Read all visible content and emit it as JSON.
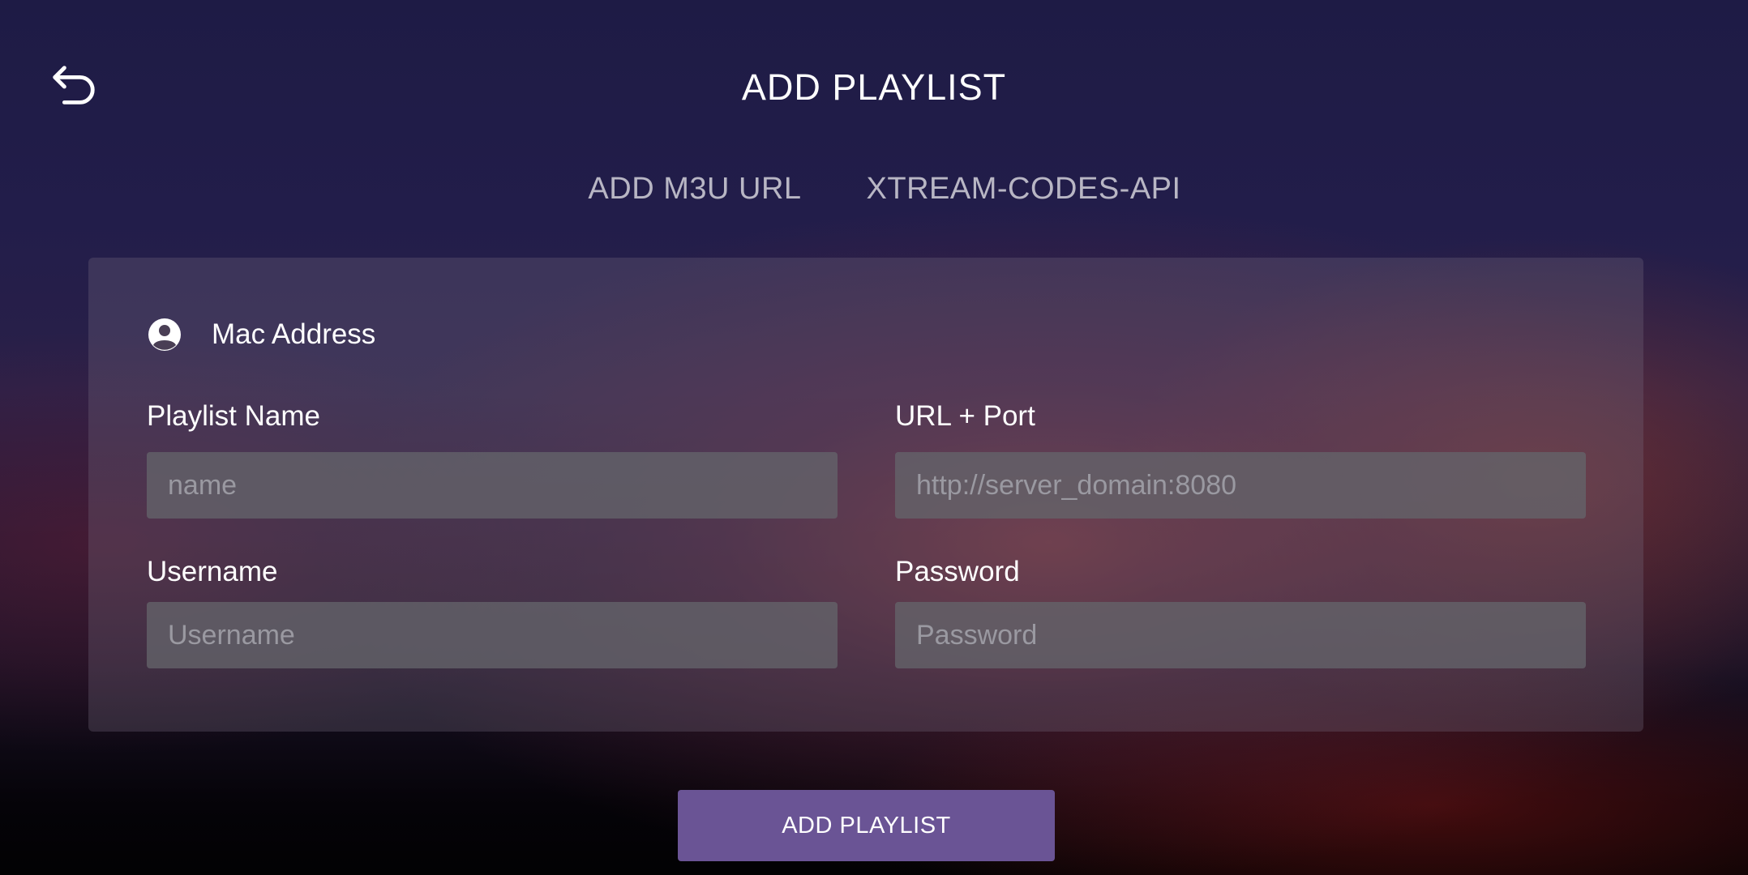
{
  "header": {
    "back_icon": "undo-arrow-icon",
    "title": "ADD PLAYLIST"
  },
  "tabs": [
    {
      "label": "ADD M3U URL"
    },
    {
      "label": "XTREAM-CODES-API"
    }
  ],
  "form": {
    "mac": {
      "icon": "account-circle-icon",
      "label": "Mac Address"
    },
    "fields": {
      "playlist_name": {
        "label": "Playlist Name",
        "placeholder": "name",
        "value": ""
      },
      "url_port": {
        "label": "URL + Port",
        "placeholder": "http://server_domain:8080",
        "value": ""
      },
      "username": {
        "label": "Username",
        "placeholder": "Username",
        "value": ""
      },
      "password": {
        "label": "Password",
        "placeholder": "Password",
        "value": ""
      }
    }
  },
  "submit": {
    "label": "ADD PLAYLIST"
  },
  "colors": {
    "button_bg": "#6a5495",
    "tab_text": "#b8b6c4",
    "input_bg": "#646469",
    "placeholder_text": "#9a99a1"
  }
}
